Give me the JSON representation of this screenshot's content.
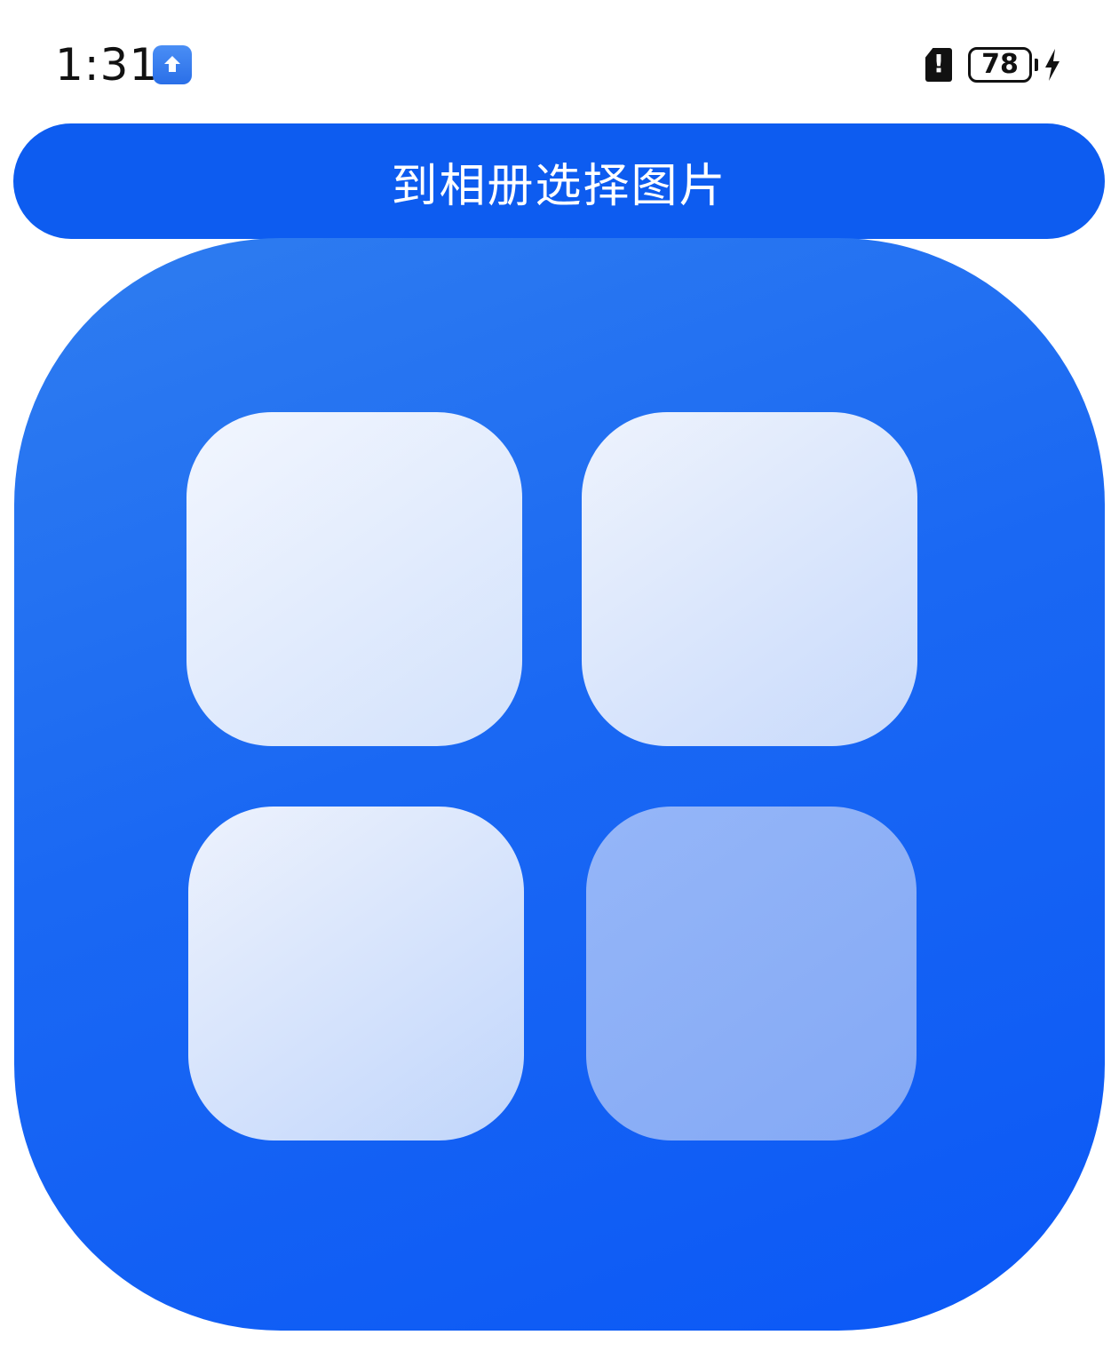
{
  "status_bar": {
    "time": "1:31",
    "notification_icon": "upload-icon",
    "sim_icon": "sim-alert-icon",
    "sim_glyph": "!",
    "battery_level": "78",
    "charging_icon": "bolt-icon"
  },
  "actions": {
    "pick_from_album_label": "到相册选择图片"
  },
  "preview_image": {
    "icon": "app-grid-icon",
    "colors": {
      "background": "#1a68f3",
      "tile_light": "#dbe7fd",
      "tile_dim": "#8caff6"
    }
  },
  "colors": {
    "button": "#0d5cf0",
    "button_text": "#ffffff"
  }
}
